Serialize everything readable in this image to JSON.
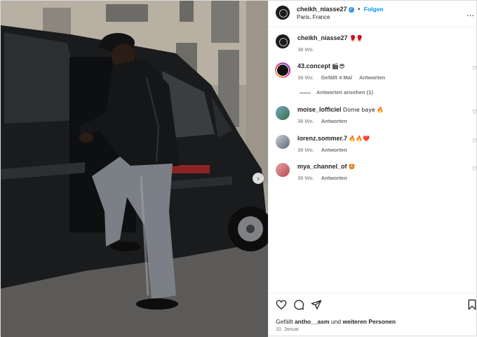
{
  "post": {
    "author": "cheikh_niasse27",
    "location": "Paris, France",
    "follow_label": "Folgen",
    "more_label": "...",
    "caption_emoji": "🥊🥊",
    "caption_time": "38 Wo."
  },
  "comments": [
    {
      "user": "43.concept",
      "text": "🎬😎",
      "time": "38 Wo.",
      "likes": "Gefällt 4 Mal",
      "reply": "Antworten",
      "avatar": "av-43"
    },
    {
      "user": "moise_lofficiel",
      "text": "Dome baye 🔥",
      "time": "38 Wo.",
      "likes": "",
      "reply": "Antworten",
      "avatar": "av-moise"
    },
    {
      "user": "lorenz.sommer.7",
      "text": "🔥🔥❤️",
      "time": "38 Wo.",
      "likes": "",
      "reply": "Antworten",
      "avatar": "av-lorenz"
    },
    {
      "user": "mya_channel_of",
      "text": "🤩",
      "time": "38 Wo.",
      "likes": "",
      "reply": "Antworten",
      "avatar": "av-mya"
    }
  ],
  "view_replies": "Antworten ansehen (1)",
  "footer": {
    "liked_prefix": "Gefällt",
    "liked_user": "antho__asm",
    "liked_and": "und",
    "liked_others": "weiteren Personen",
    "date": "10. Januar"
  },
  "colors": {
    "accent": "#0095f6",
    "verified": "#3897f0",
    "muted": "#737373"
  }
}
